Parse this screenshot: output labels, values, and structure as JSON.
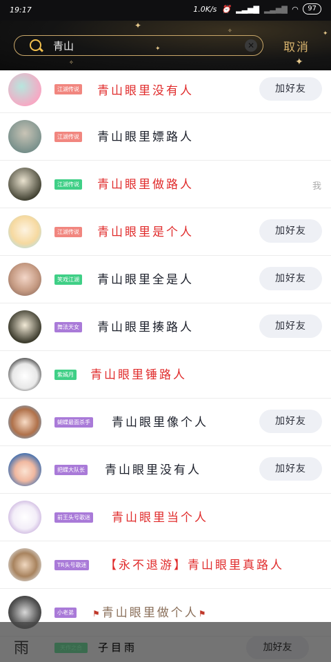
{
  "status_bar": {
    "time": "19:17",
    "speed": "1.0K/s",
    "battery": "97"
  },
  "search": {
    "value": "青山",
    "cancel_label": "取消"
  },
  "add_label": "加好友",
  "colors": {
    "tag_pink": "#f1867f",
    "tag_green": "#3fcf86",
    "tag_purple": "#a97ad8",
    "name_red": "#e02b2b",
    "name_dark": "#1b1f2a"
  },
  "results": [
    {
      "tag": "江湖传说",
      "name": "青山眼里没有人",
      "name_color": "red",
      "action": "add"
    },
    {
      "tag": "江湖传说",
      "name": "青山眼里嫖路人",
      "name_color": "dark",
      "action": "none"
    },
    {
      "tag": "江湖传说",
      "name": "青山眼里做路人",
      "name_color": "red",
      "action": "me",
      "me_label": "我"
    },
    {
      "tag": "江湖传说",
      "name": "青山眼里是个人",
      "name_color": "red",
      "action": "add"
    },
    {
      "tag": "笑戏江湖",
      "name": "青山眼里全是人",
      "name_color": "dark",
      "action": "add"
    },
    {
      "tag": "舞法天女",
      "name": "青山眼里揍路人",
      "name_color": "dark",
      "action": "add"
    },
    {
      "tag": "紫嫣月",
      "name": "青山眼里锤路人",
      "name_color": "red",
      "action": "none"
    },
    {
      "tag": "蝴蝶最面杀手",
      "name": "青山眼里像个人",
      "name_color": "dark",
      "action": "add"
    },
    {
      "tag": "把蝶大队长",
      "name": "青山眼里没有人",
      "name_color": "dark",
      "action": "none",
      "show_add": true
    },
    {
      "tag": "前王头号歌迷",
      "name": "青山眼里当个人",
      "name_color": "red",
      "action": "none"
    },
    {
      "tag": "TR头号歌迷",
      "name": "【永不退游】青山眼里真路人",
      "name_color": "red",
      "action": "none"
    },
    {
      "tag": "小老弟",
      "name": "青山眼里做个人",
      "name_color": "flag",
      "action": "none"
    }
  ],
  "overlay": {
    "tag": "天作之合",
    "name": "子目雨",
    "add_label": "加好友",
    "logo": "雨"
  }
}
